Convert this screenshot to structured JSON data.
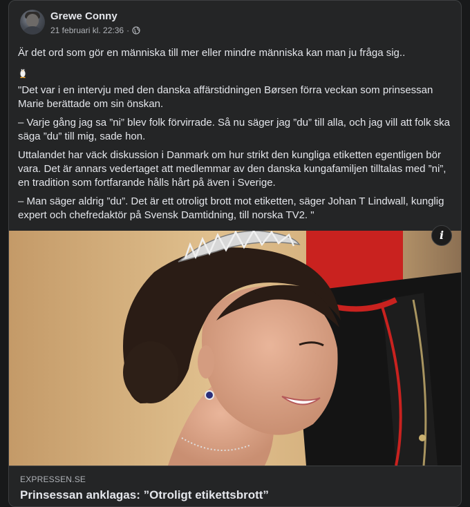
{
  "post": {
    "author": "Grewe Conny",
    "timestamp": "21 februari kl. 22:36",
    "separator": "·",
    "privacy_icon": "globe-icon",
    "paragraphs": [
      "Är det ord som gör en människa till mer eller mindre människa kan man ju fråga sig..",
      "\"Det var i en intervju med den danska affärstidningen Børsen förra veckan som prinsessan Marie berättade om sin önskan.",
      "– Varje gång jag sa ”ni” blev folk förvirrade. Så nu säger jag ”du” till alla, och jag vill att folk ska säga ”du” till mig, sade hon.",
      "Uttalandet har väck diskussion i Danmark om hur strikt den kungliga etiketten egentligen bör vara. Det är annars vedertaget att medlemmar av den danska kungafamiljen tilltalas med ”ni”, en tradition som fortfarande hålls hårt på även i Sverige.",
      "– Man säger aldrig ”du”. Det är ett otroligt brott mot etiketten, säger Johan T Lindwall, kunglig expert och chefredaktör på Svensk Damtidning, till norska TV2. \""
    ],
    "emoji": "penguin-emoji"
  },
  "link_preview": {
    "domain": "EXPRESSEN.SE",
    "title": "Prinsessan anklagas: ”Otroligt etikettsbrott”",
    "info_icon": "info-icon",
    "info_label": "i"
  },
  "colors": {
    "background": "#18191a",
    "card": "#242526",
    "text": "#e4e6eb",
    "secondary_text": "#b0b3b8"
  }
}
